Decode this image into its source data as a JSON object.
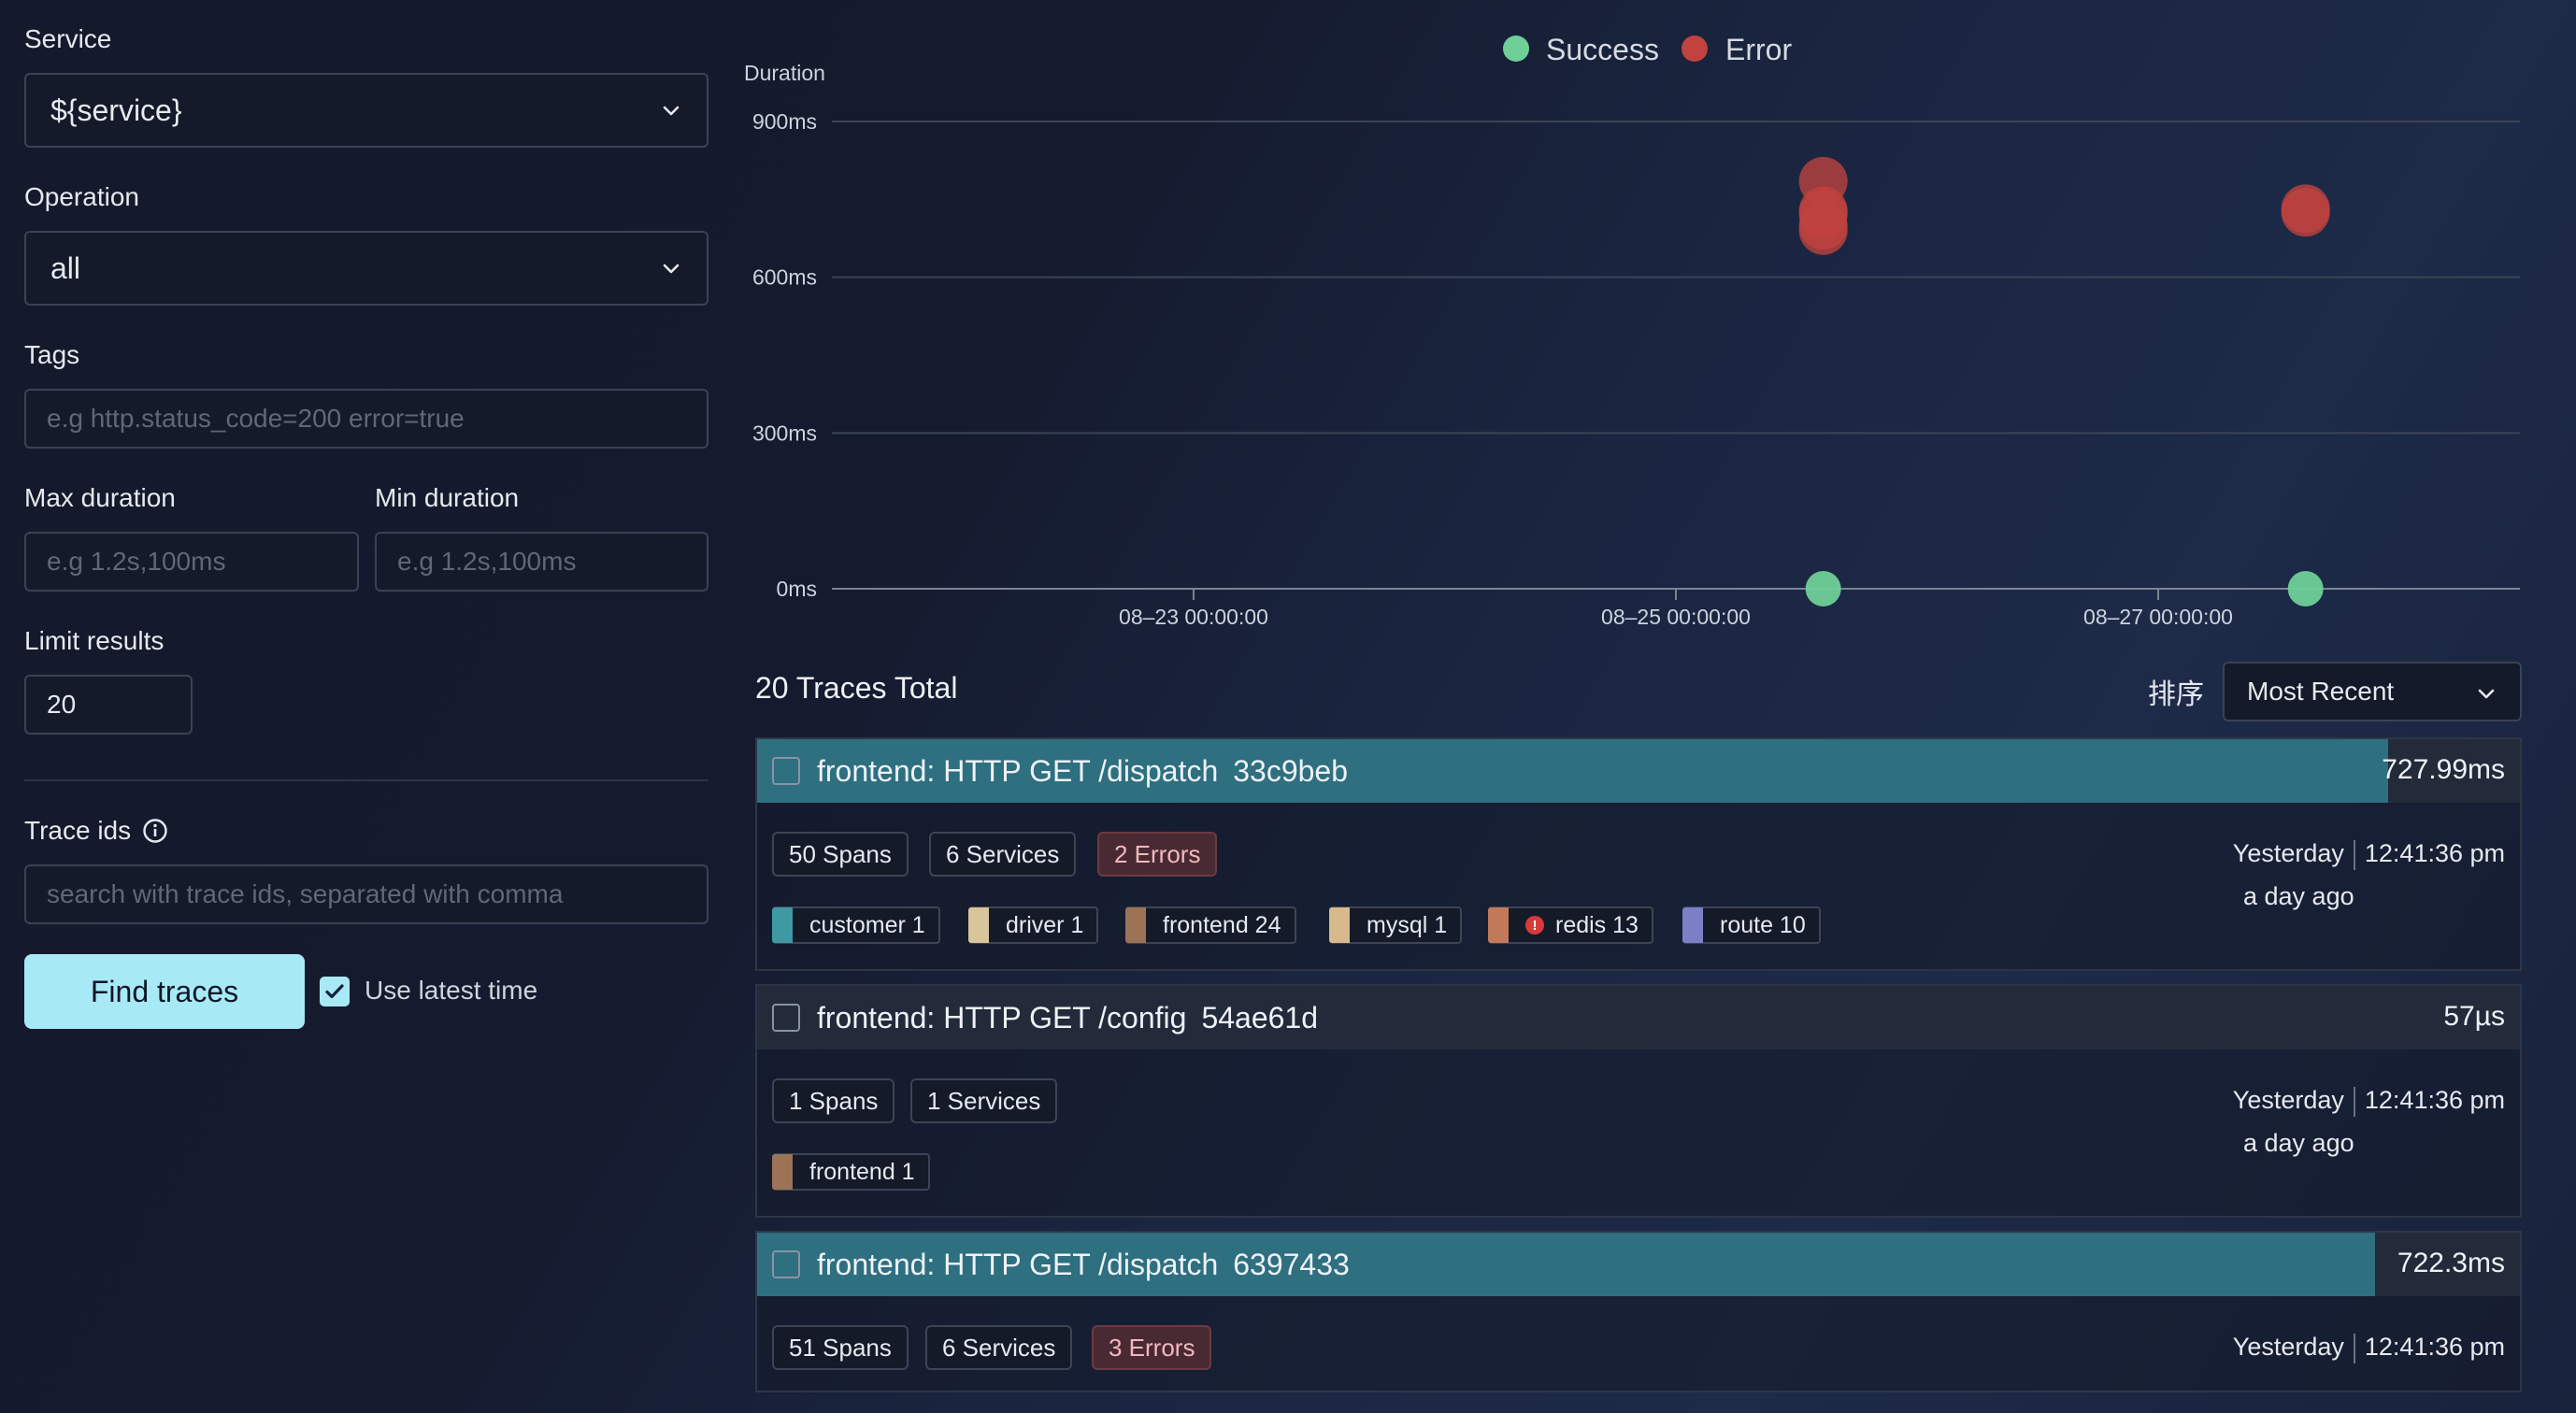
{
  "search": {
    "service_label": "Service",
    "service_value": "${service}",
    "operation_label": "Operation",
    "operation_value": "all",
    "tags_label": "Tags",
    "tags_placeholder": "e.g http.status_code=200 error=true",
    "max_duration_label": "Max duration",
    "max_duration_placeholder": "e.g 1.2s,100ms",
    "min_duration_label": "Min duration",
    "min_duration_placeholder": "e.g 1.2s,100ms",
    "limit_label": "Limit results",
    "limit_value": "20",
    "trace_ids_label": "Trace ids",
    "trace_ids_placeholder": "search with trace ids, separated with comma",
    "find_button": "Find traces",
    "use_latest_label": "Use latest time",
    "use_latest_checked": true
  },
  "chart_data": {
    "type": "scatter",
    "title": "",
    "ylabel": "Duration",
    "ylim": [
      0,
      900
    ],
    "yticks": [
      "0ms",
      "300ms",
      "600ms",
      "900ms"
    ],
    "xticks": [
      "08–23 00:00:00",
      "08–25 00:00:00",
      "08–27 00:00:00"
    ],
    "xlim": [
      "08-21 12:00",
      "08-28 12:00"
    ],
    "legend": [
      "Success",
      "Error"
    ],
    "legend_position": "top",
    "colors": {
      "Success": "#6fcf97",
      "Error": "#c0433f"
    },
    "series": [
      {
        "name": "Success",
        "points": [
          [
            "08-25 14:40",
            0
          ],
          [
            "08-27 14:40",
            0
          ]
        ]
      },
      {
        "name": "Error",
        "points": [
          [
            "08-25 14:40",
            785
          ],
          [
            "08-25 14:40",
            728
          ],
          [
            "08-25 14:40",
            722
          ],
          [
            "08-25 14:40",
            700
          ],
          [
            "08-25 14:40",
            690
          ],
          [
            "08-27 14:40",
            732
          ],
          [
            "08-27 14:40",
            725
          ]
        ]
      }
    ]
  },
  "list": {
    "total": "20 Traces Total",
    "sort_label": "排序",
    "sort_value": "Most Recent"
  },
  "traces": [
    {
      "name": "frontend: HTTP GET /dispatch",
      "id": "33c9beb",
      "duration": "727.99ms",
      "bar_fraction": 0.925,
      "spans": "50 Spans",
      "services": "6 Services",
      "errors": "2 Errors",
      "service_tags": [
        {
          "label": "customer 1",
          "color": "#3e99a5"
        },
        {
          "label": "driver 1",
          "color": "#d8c59b"
        },
        {
          "label": "frontend 24",
          "color": "#9c7357"
        },
        {
          "label": "mysql 1",
          "color": "#d8b98e"
        },
        {
          "label": "redis 13",
          "color": "#c2795a",
          "error": true
        },
        {
          "label": "route 10",
          "color": "#7b80c6"
        }
      ],
      "day": "Yesterday",
      "time": "12:41:36 pm",
      "ago": "a day ago"
    },
    {
      "name": "frontend: HTTP GET /config",
      "id": "54ae61d",
      "duration": "57µs",
      "bar_fraction": 0,
      "spans": "1 Spans",
      "services": "1 Services",
      "service_tags": [
        {
          "label": "frontend 1",
          "color": "#9c7357"
        }
      ],
      "day": "Yesterday",
      "time": "12:41:36 pm",
      "ago": "a day ago"
    },
    {
      "name": "frontend: HTTP GET /dispatch",
      "id": "6397433",
      "duration": "722.3ms",
      "bar_fraction": 0.918,
      "spans": "51 Spans",
      "services": "6 Services",
      "errors": "3 Errors",
      "day": "Yesterday",
      "time": "12:41:36 pm"
    }
  ]
}
